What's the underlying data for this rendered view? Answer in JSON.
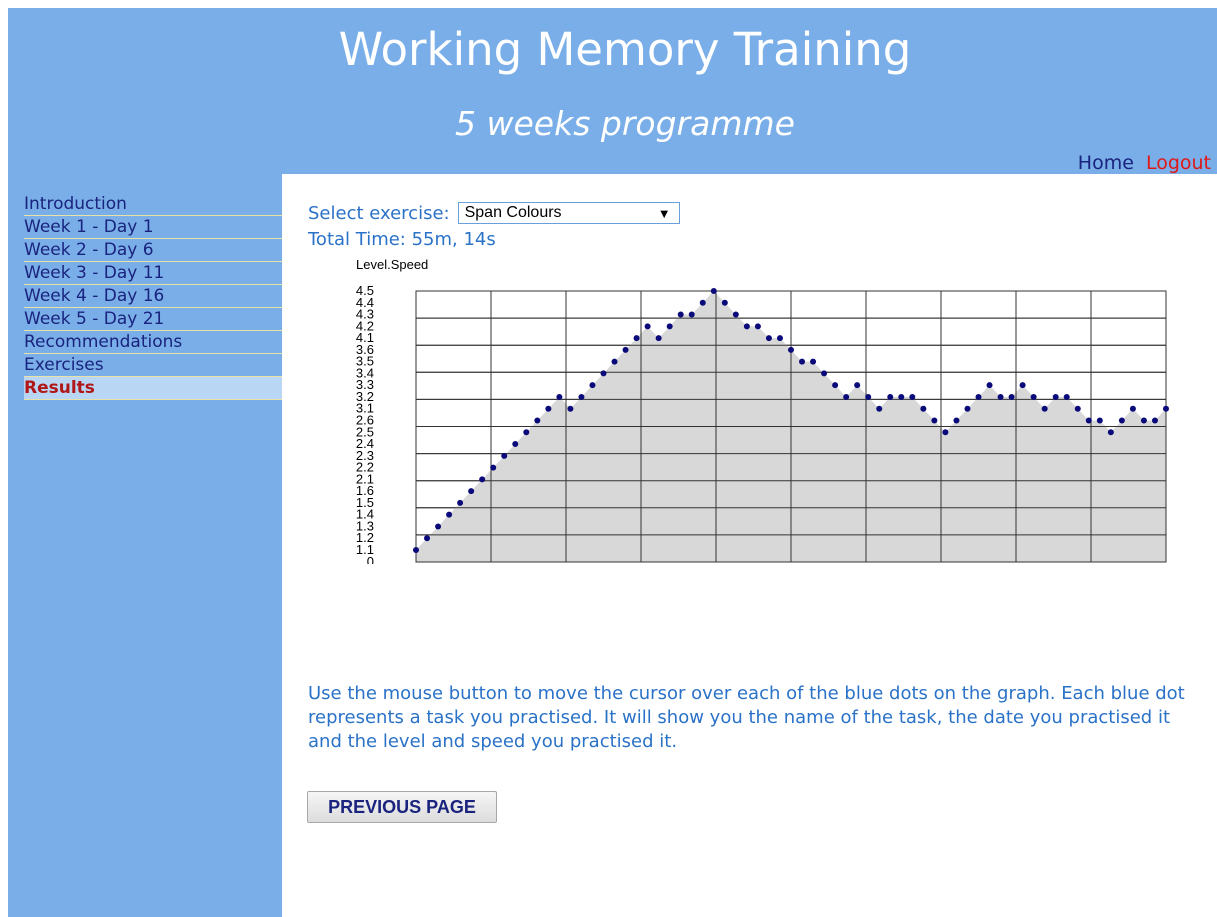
{
  "header": {
    "title": "Working Memory Training",
    "subtitle": "5 weeks programme"
  },
  "top_nav": {
    "home": "Home",
    "logout": "Logout"
  },
  "sidebar": {
    "items": [
      {
        "label": "Introduction"
      },
      {
        "label": "Week 1 - Day 1"
      },
      {
        "label": "Week 2 - Day 6"
      },
      {
        "label": "Week 3 - Day 11"
      },
      {
        "label": "Week 4 - Day 16"
      },
      {
        "label": "Week 5 - Day 21"
      },
      {
        "label": "Recommendations"
      },
      {
        "label": "Exercises"
      },
      {
        "label": "Results",
        "active": true
      }
    ]
  },
  "main": {
    "select_label": "Select exercise:",
    "select_value": "Span Colours",
    "select_arrow": "▼",
    "total_time": "Total Time: 55m, 14s",
    "instructions": "Use the mouse button to move the cursor over each of the blue dots on the graph. Each blue dot represents a task you practised. It will show you the name of the task, the date you practised it and the level and speed you practised it.",
    "prev_button": "PREVIOUS PAGE"
  },
  "colors": {
    "header_bg": "#7aaee8",
    "dot": "#0a0a7a",
    "fill": "#d8d8d8",
    "text_blue": "#2a72c8",
    "active_red": "#b01818"
  },
  "chart_data": {
    "type": "area",
    "ylabel": "Level.Speed",
    "yticks": [
      "0",
      "1.1",
      "1.2",
      "1.3",
      "1.4",
      "1.5",
      "1.6",
      "2.1",
      "2.2",
      "2.3",
      "2.4",
      "2.5",
      "2.6",
      "3.1",
      "3.2",
      "3.3",
      "3.4",
      "3.5",
      "3.6",
      "4.1",
      "4.2",
      "4.3",
      "4.4",
      "4.5"
    ],
    "grid": true,
    "x": [
      1,
      2,
      3,
      4,
      5,
      6,
      7,
      8,
      9,
      10,
      11,
      12,
      13,
      14,
      15,
      16,
      17,
      18,
      19,
      20,
      21,
      22,
      23,
      24,
      25,
      26,
      27,
      28,
      29,
      30,
      31,
      32,
      33,
      34,
      35,
      36,
      37,
      38,
      39,
      40,
      41,
      42,
      43,
      44,
      45,
      46,
      47,
      48,
      49,
      50,
      51,
      52,
      53,
      54,
      55,
      56,
      57,
      58,
      59,
      60,
      61,
      62,
      63,
      64,
      65,
      66,
      67,
      68,
      69
    ],
    "values": [
      "1.1",
      "1.2",
      "1.3",
      "1.4",
      "1.5",
      "1.6",
      "2.1",
      "2.2",
      "2.3",
      "2.4",
      "2.5",
      "2.6",
      "3.1",
      "3.2",
      "3.1",
      "3.2",
      "3.3",
      "3.4",
      "3.5",
      "3.6",
      "4.1",
      "4.2",
      "4.1",
      "4.2",
      "4.3",
      "4.3",
      "4.4",
      "4.5",
      "4.4",
      "4.3",
      "4.2",
      "4.2",
      "4.1",
      "4.1",
      "3.6",
      "3.5",
      "3.5",
      "3.4",
      "3.3",
      "3.2",
      "3.3",
      "3.2",
      "3.1",
      "3.2",
      "3.2",
      "3.2",
      "3.1",
      "2.6",
      "2.5",
      "2.6",
      "3.1",
      "3.2",
      "3.3",
      "3.2",
      "3.2",
      "3.3",
      "3.2",
      "3.1",
      "3.2",
      "3.2",
      "3.1",
      "2.6",
      "2.6",
      "2.5",
      "2.6",
      "3.1",
      "2.6",
      "2.6",
      "3.1"
    ]
  }
}
